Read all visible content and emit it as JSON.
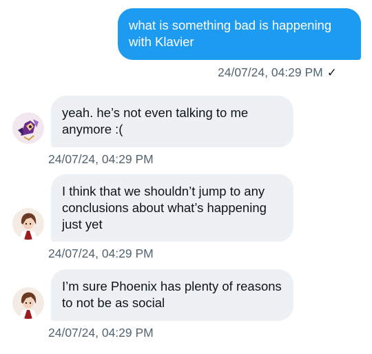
{
  "colors": {
    "sent_bubble": "#1d9bf0",
    "received_bubble": "#eef1f4",
    "timestamp": "#536471",
    "text_dark": "#0f1419"
  },
  "messages": [
    {
      "direction": "outgoing",
      "text": "what is something bad is happening with Klavier",
      "timestamp": "24/07/24, 04:29 PM",
      "status_icon": "checkmark-icon",
      "status_glyph": "✓"
    },
    {
      "direction": "incoming",
      "avatar": "purple-character-avatar",
      "text": "yeah. he’s not even talking to me anymore :(",
      "timestamp": "24/07/24, 04:29 PM"
    },
    {
      "direction": "incoming",
      "avatar": "brown-haired-character-avatar",
      "text": "I think that we shouldn’t jump to any conclusions about what’s happening just yet",
      "timestamp": "24/07/24, 04:29 PM"
    },
    {
      "direction": "incoming",
      "avatar": "brown-haired-character-avatar",
      "text": "I’m sure Phoenix has plenty of reasons to not be as social",
      "timestamp": "24/07/24, 04:29 PM"
    }
  ]
}
